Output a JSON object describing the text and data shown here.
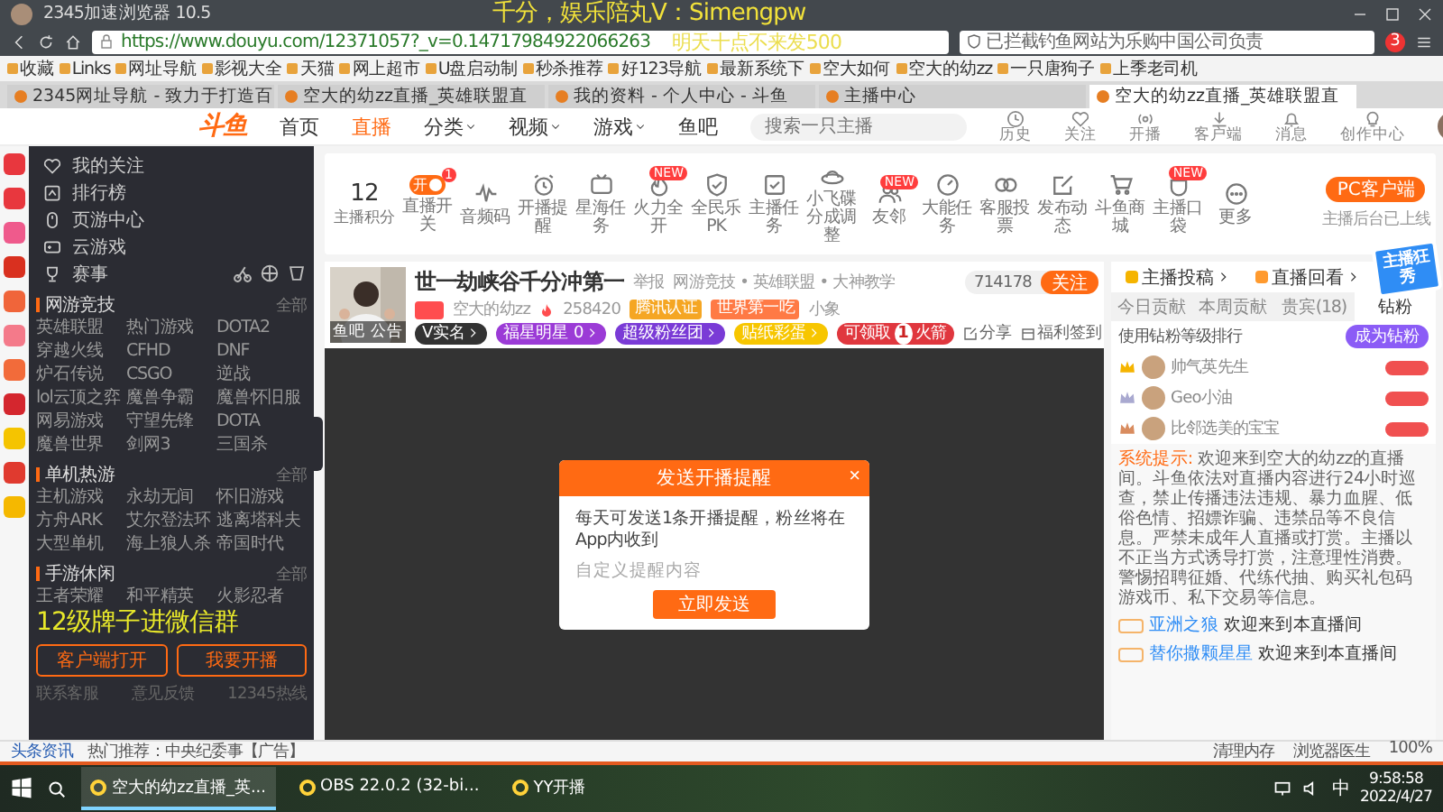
{
  "browser": {
    "title": "2345加速浏览器 10.5",
    "overlay_lines": [
      "千分，娱乐陪丸V：Simengpw",
      "明天十点不来发500"
    ],
    "url": "https://www.douyu.com/12371057?_v=0.14717984922066263",
    "notice": "已拦截钓鱼网站为乐购中国公司负责",
    "notice_count": "3",
    "bookmarks": [
      {
        "label": "收藏"
      },
      {
        "label": "Links"
      },
      {
        "label": "网址导航"
      },
      {
        "label": "影视大全"
      },
      {
        "label": "天猫"
      },
      {
        "label": "网上超市"
      },
      {
        "label": "U盘启动制"
      },
      {
        "label": "秒杀推荐"
      },
      {
        "label": "好123导航"
      },
      {
        "label": "最新系统下"
      },
      {
        "label": "空大如何"
      },
      {
        "label": "空大的幼zz"
      },
      {
        "label": "一只唐狗子"
      },
      {
        "label": "上季老司机"
      }
    ],
    "tabs": [
      {
        "label": "2345网址导航 - 致力于打造百",
        "selected": false
      },
      {
        "label": "空大的幼zz直播_英雄联盟直",
        "selected": false
      },
      {
        "label": "我的资料 - 个人中心 - 斗鱼",
        "selected": false
      },
      {
        "label": "主播中心",
        "selected": false
      },
      {
        "label": "空大的幼zz直播_英雄联盟直",
        "selected": true
      }
    ]
  },
  "site_header": {
    "logo": "斗鱼",
    "nav": [
      {
        "label": "首页",
        "selected": false,
        "dropdown": false
      },
      {
        "label": "直播",
        "selected": true,
        "dropdown": false
      },
      {
        "label": "分类",
        "selected": false,
        "dropdown": true
      },
      {
        "label": "视频",
        "selected": false,
        "dropdown": true
      },
      {
        "label": "游戏",
        "selected": false,
        "dropdown": true
      },
      {
        "label": "鱼吧",
        "selected": false,
        "dropdown": false
      }
    ],
    "search": {
      "placeholder": "搜索一只主播"
    },
    "actions": [
      {
        "label": "历史"
      },
      {
        "label": "关注"
      },
      {
        "label": "开播"
      },
      {
        "label": "客户端"
      },
      {
        "label": "消息"
      },
      {
        "label": "创作中心"
      }
    ]
  },
  "toolbar": {
    "score": "12",
    "score_label": "主播积分",
    "items": [
      {
        "label": "直播开关",
        "toggle_text": "开",
        "on": true,
        "badge": "1"
      },
      {
        "label": "音频码"
      },
      {
        "label": "开播提醒"
      },
      {
        "label": "星海任务"
      },
      {
        "label": "火力全开",
        "badge": "NEW"
      },
      {
        "label": "全民乐PK"
      },
      {
        "label": "主播任务"
      },
      {
        "label": "小飞碟分成调整"
      },
      {
        "label": "友邻",
        "badge": "NEW"
      },
      {
        "label": "大能任务"
      },
      {
        "label": "客服投票"
      },
      {
        "label": "发布动态"
      },
      {
        "label": "斗鱼商城"
      },
      {
        "label": "主播口袋",
        "badge": "NEW"
      },
      {
        "label": "更多"
      }
    ],
    "pc_button": "PC客户端",
    "pc_note": "主播后台已上线"
  },
  "icon_strip": [
    {
      "color": "#e8373e"
    },
    {
      "color": "#e8373e"
    },
    {
      "color": "#ef5a8c"
    },
    {
      "color": "#d9301f"
    },
    {
      "color": "#f0653a"
    },
    {
      "color": "#f47a8a"
    },
    {
      "color": "#f26b3a"
    },
    {
      "color": "#d4262e"
    },
    {
      "color": "#f5c400"
    },
    {
      "color": "#e03a2f"
    },
    {
      "color": "#f5b800"
    }
  ],
  "sidebar": {
    "menu": [
      {
        "label": "我的关注"
      },
      {
        "label": "排行榜"
      },
      {
        "label": "页游中心"
      },
      {
        "label": "云游戏"
      },
      {
        "label": "赛事"
      }
    ],
    "sections": [
      {
        "title": "网游竞技",
        "more": "全部",
        "items": [
          "英雄联盟",
          "热门游戏",
          "DOTA2",
          "穿越火线",
          "CFHD",
          "DNF",
          "炉石传说",
          "CSGO",
          "逆战",
          "lol云顶之弈",
          "魔兽争霸",
          "魔兽怀旧服",
          "网易游戏",
          "守望先锋",
          "DOTA",
          "魔兽世界",
          "剑网3",
          "三国杀"
        ]
      },
      {
        "title": "单机热游",
        "more": "全部",
        "items": [
          "主机游戏",
          "永劫无间",
          "怀旧游戏",
          "方舟ARK",
          "艾尔登法环",
          "逃离塔科夫",
          "大型单机",
          "海上狼人杀",
          "帝国时代"
        ]
      },
      {
        "title": "手游休闲",
        "more": "全部",
        "items": [
          "王者荣耀",
          "和平精英",
          "火影忍者"
        ]
      }
    ],
    "caption": "12级牌子进微信群",
    "buttons": [
      "客户端打开",
      "我要开播"
    ],
    "footer": [
      "联系客服",
      "意见反馈",
      "12345热线"
    ]
  },
  "streamer": {
    "avatar_links": [
      "鱼吧",
      "公告"
    ],
    "title": "世一劫峡谷千分冲第一",
    "report": "举报",
    "category": "网游竞技 • 英雄联盟 • 大神教学",
    "name": "空大的幼zz",
    "heat": "258420",
    "tags": [
      {
        "label": "腾讯认证",
        "color": "#f5a623"
      },
      {
        "label": "世界第一吃",
        "color": "#ff7a45"
      }
    ],
    "fans_tag": "小象",
    "pills": [
      {
        "label": "V实名",
        "color": "#333333"
      },
      {
        "label": "福星明星",
        "count": "0",
        "color": "#9b3bd6"
      },
      {
        "label": "超级粉丝团",
        "color": "#7a3bd6"
      },
      {
        "label": "贴纸彩蛋",
        "color": "#f7c600"
      }
    ],
    "followers": "714178",
    "follow": "关注",
    "rocket": [
      "可领取",
      "1",
      "火箭"
    ],
    "share": "分享",
    "sign": "福利签到"
  },
  "dialog": {
    "title": "发送开播提醒",
    "close": "×",
    "body": "每天可发送1条开播提醒，粉丝将在App内收到",
    "placeholder": "自定义提醒内容",
    "button": "立即发送"
  },
  "side_panel": {
    "links": [
      "主播投稿",
      "直播回看"
    ],
    "promo": "主播狂秀",
    "tabs": [
      {
        "label": "今日贡献",
        "selected": false
      },
      {
        "label": "本周贡献",
        "selected": false
      },
      {
        "label": "贵宾(18)",
        "selected": false
      },
      {
        "label": "钻粉",
        "selected": true
      }
    ],
    "rank_title": "使用钻粉等级排行",
    "rank_button": "成为钻粉",
    "ranks": [
      {
        "name": "帅气英先生",
        "color": "#f5b400"
      },
      {
        "name": "Geo小油",
        "color": "#a9a9d0"
      },
      {
        "name": "比邻选美的宝宝",
        "color": "#d98c5f"
      }
    ],
    "system": {
      "label": "系统提示:",
      "text": "欢迎来到空大的幼zz的直播间。斗鱼依法对直播内容进行24小时巡查，禁止传播违法违规、暴力血腥、低俗色情、招嫖诈骗、违禁品等不良信息。严禁未成年人直播或打赏。主播以不正当方式诱导打赏，注意理性消费。警惕招聘征婚、代练代抽、购买礼包码游戏币、私下交易等信息。"
    },
    "messages": [
      {
        "user": "亚洲之狼",
        "text": "欢迎来到本直播间"
      },
      {
        "user": "替你撒颗星星",
        "text": "欢迎来到本直播间"
      }
    ]
  },
  "status_bar": {
    "news": "头条资讯",
    "ad": "热门推荐：中央纪委事【广告】",
    "tools": [
      "清理内存",
      "浏览器医生"
    ],
    "zoom": "100%"
  },
  "taskbar": {
    "tasks": [
      {
        "label": "空大的幼zz直播_英...",
        "selected": true
      },
      {
        "label": "OBS 22.0.2 (32-bi...",
        "selected": false
      },
      {
        "label": "YY开播",
        "selected": false
      }
    ],
    "ime": "中",
    "time": "9:58:58",
    "date": "2022/4/27"
  }
}
